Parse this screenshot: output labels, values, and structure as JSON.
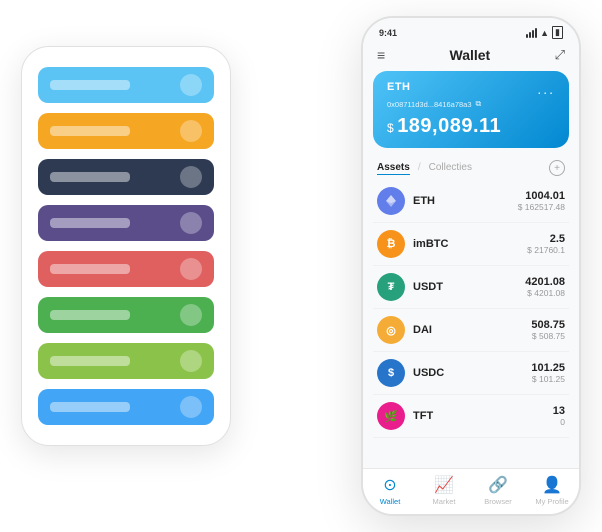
{
  "left_phone": {
    "cards": [
      {
        "color": "card-blue",
        "label": ""
      },
      {
        "color": "card-orange",
        "label": ""
      },
      {
        "color": "card-dark",
        "label": ""
      },
      {
        "color": "card-purple",
        "label": ""
      },
      {
        "color": "card-red",
        "label": ""
      },
      {
        "color": "card-green",
        "label": ""
      },
      {
        "color": "card-light-green",
        "label": ""
      },
      {
        "color": "card-light-blue",
        "label": ""
      }
    ]
  },
  "right_phone": {
    "status_bar": {
      "time": "9:41"
    },
    "header": {
      "title": "Wallet"
    },
    "eth_card": {
      "label": "ETH",
      "address": "0x08711d3d...8416a78a3",
      "dots": "...",
      "currency_symbol": "$",
      "amount": "189,089.11"
    },
    "assets_section": {
      "tab_active": "Assets",
      "tab_separator": "/",
      "tab_inactive": "Collecties",
      "add_icon": "+"
    },
    "assets": [
      {
        "name": "ETH",
        "amount": "1004.01",
        "usd": "$ 162517.48",
        "icon_color": "#627eea",
        "icon_char": "♦"
      },
      {
        "name": "imBTC",
        "amount": "2.5",
        "usd": "$ 21760.1",
        "icon_color": "#f7931a",
        "icon_char": "₿"
      },
      {
        "name": "USDT",
        "amount": "4201.08",
        "usd": "$ 4201.08",
        "icon_color": "#26a17b",
        "icon_char": "₮"
      },
      {
        "name": "DAI",
        "amount": "508.75",
        "usd": "$ 508.75",
        "icon_color": "#f5ac37",
        "icon_char": "D"
      },
      {
        "name": "USDC",
        "amount": "101.25",
        "usd": "$ 101.25",
        "icon_color": "#2775ca",
        "icon_char": "$"
      },
      {
        "name": "TFT",
        "amount": "13",
        "usd": "0",
        "icon_color": "#e91e8c",
        "icon_char": "T"
      }
    ],
    "nav": [
      {
        "label": "Wallet",
        "active": true,
        "icon": "wallet"
      },
      {
        "label": "Market",
        "active": false,
        "icon": "market"
      },
      {
        "label": "Browser",
        "active": false,
        "icon": "browser"
      },
      {
        "label": "My Profile",
        "active": false,
        "icon": "profile"
      }
    ]
  }
}
